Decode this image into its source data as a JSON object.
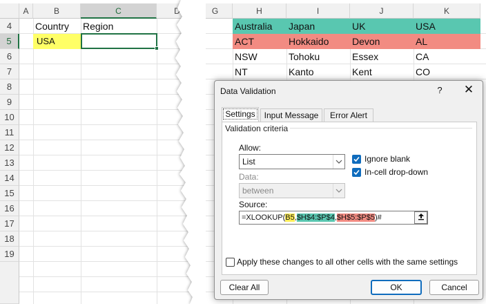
{
  "sheet": {
    "columns_left": [
      "A",
      "B",
      "C",
      "D"
    ],
    "columns_right": [
      "G",
      "H",
      "I",
      "J",
      "K"
    ],
    "rows": [
      "4",
      "5",
      "6",
      "7",
      "8",
      "9",
      "10",
      "11",
      "12",
      "13",
      "14",
      "15",
      "16",
      "17",
      "18",
      "19"
    ],
    "b4": "Country",
    "c4": "Region",
    "b5": "USA",
    "table": {
      "header": [
        "Australia",
        "Japan",
        "UK",
        "USA"
      ],
      "rows": [
        [
          "ACT",
          "Hokkaido",
          "Devon",
          "AL"
        ],
        [
          "NSW",
          "Tohoku",
          "Essex",
          "CA"
        ],
        [
          "NT",
          "Kanto",
          "Kent",
          "CO"
        ]
      ]
    },
    "colors": {
      "yellow": "#ffff66",
      "teal": "#59c7b0",
      "salmon": "#f28b82",
      "select_green": "#1f7244"
    }
  },
  "dialog": {
    "title": "Data Validation",
    "help": "?",
    "close": "✕",
    "tabs": [
      "Settings",
      "Input Message",
      "Error Alert"
    ],
    "group_label": "Validation criteria",
    "allow_label": "Allow:",
    "allow_value": "List",
    "data_label": "Data:",
    "data_value": "between",
    "ignore_blank": "Ignore blank",
    "in_cell_dropdown": "In-cell drop-down",
    "source_label": "Source:",
    "source_parts": [
      "=XLOOKUP(",
      "B5",
      ",",
      "$H$4:$P$4",
      ",",
      "$H$5:$P$5",
      ")#"
    ],
    "apply_all": "Apply these changes to all other cells with the same settings",
    "clear_all": "Clear All",
    "ok": "OK",
    "cancel": "Cancel"
  }
}
